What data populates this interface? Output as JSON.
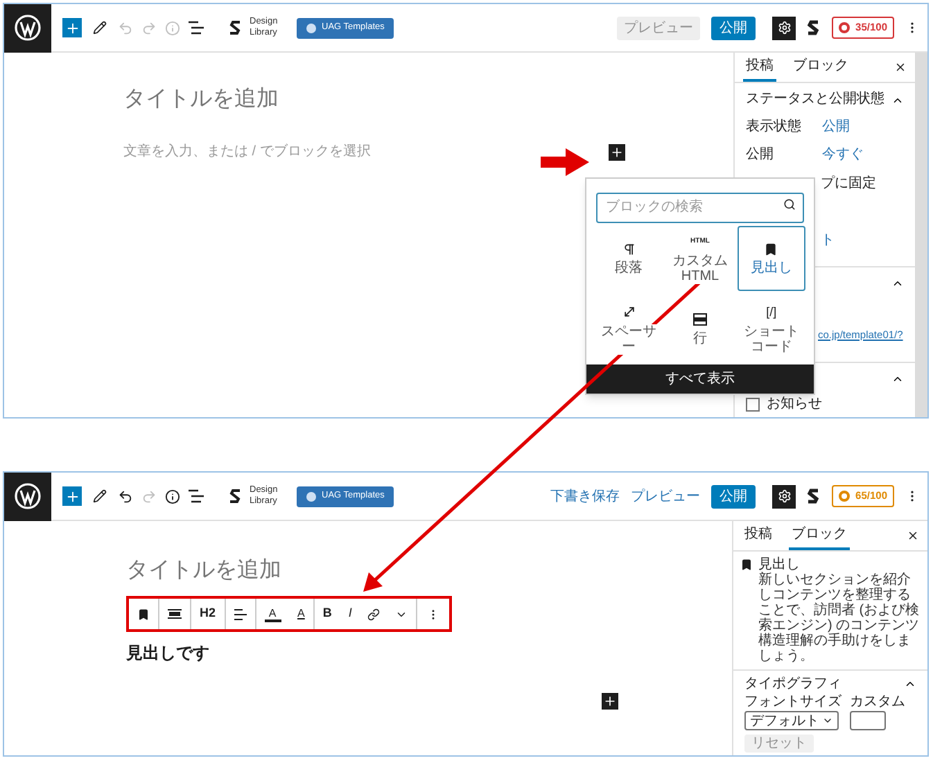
{
  "screens": [
    {
      "toolbar": {
        "design_library": "Design Library",
        "templates": "UAG Templates",
        "undo_disabled": true,
        "info_disabled": true,
        "actions": [
          {
            "kind": "button",
            "label": "プレビュー",
            "disabled": true
          },
          {
            "kind": "primary",
            "label": "公開",
            "disabled": false
          }
        ],
        "score": {
          "label": "35/100",
          "kind": "poor"
        }
      },
      "editor": {
        "title_placeholder": "タイトルを追加",
        "paragraph_placeholder": "文章を入力、または / でブロックを選択"
      },
      "inserter": {
        "search_placeholder": "ブロックの検索",
        "blocks": [
          {
            "kind": "paragraph",
            "label": "段落",
            "selected": false
          },
          {
            "kind": "html",
            "icon_text": "HTML",
            "label": "カスタム HTML",
            "selected": false
          },
          {
            "kind": "heading",
            "label": "見出し",
            "selected": true
          },
          {
            "kind": "spacer",
            "label": "スペーサー",
            "selected": false
          },
          {
            "kind": "row",
            "label": "行",
            "selected": false
          },
          {
            "kind": "shortcode",
            "icon_text": "[/]",
            "label": "ショートコード",
            "selected": false
          }
        ],
        "browse_all": "すべて表示"
      },
      "sidebar": {
        "tabs": [
          {
            "label": "投稿",
            "selected": true
          },
          {
            "label": "ブロック",
            "selected": false
          }
        ],
        "status_panel": {
          "title": "ステータスと公開状態",
          "expanded": true,
          "rows": [
            {
              "label": "表示状態",
              "value": "公開"
            },
            {
              "label": "公開",
              "value": "今すぐ"
            }
          ],
          "sticky_fragment": "プに固定",
          "link_fragment": "ト"
        },
        "url_fragment": "co.jp/template01/?",
        "categories": [
          {
            "label": "お知らせ",
            "checked": false
          }
        ]
      }
    },
    {
      "toolbar": {
        "design_library": "Design Library",
        "templates": "UAG Templates",
        "undo_disabled": false,
        "info_disabled": false,
        "actions": [
          {
            "kind": "link",
            "label": "下書き保存",
            "disabled": false
          },
          {
            "kind": "link",
            "label": "プレビュー",
            "disabled": false
          },
          {
            "kind": "primary",
            "label": "公開",
            "disabled": false
          }
        ],
        "score": {
          "label": "65/100",
          "kind": "fair"
        }
      },
      "editor": {
        "title_placeholder": "タイトルを追加",
        "heading": "見出しです",
        "block_toolbar": {
          "level_label": "H2",
          "text_color_label": "A",
          "highlight_label": "A",
          "bold_label": "B",
          "italic_label": "I"
        }
      },
      "sidebar": {
        "tabs": [
          {
            "label": "投稿",
            "selected": false
          },
          {
            "label": "ブロック",
            "selected": true
          }
        ],
        "block_card": {
          "title": "見出し",
          "description": "新しいセクションを紹介しコンテンツを整理することで、訪問者 (および検索エンジン) のコンテンツ構造理解の手助けをしましょう。"
        },
        "typography": {
          "title": "タイポグラフィ",
          "expanded": true,
          "font_size_label": "フォントサイズ",
          "custom_label": "カスタム",
          "font_size_value": "デフォルト",
          "reset": "リセット",
          "reset_disabled": true
        }
      }
    }
  ]
}
